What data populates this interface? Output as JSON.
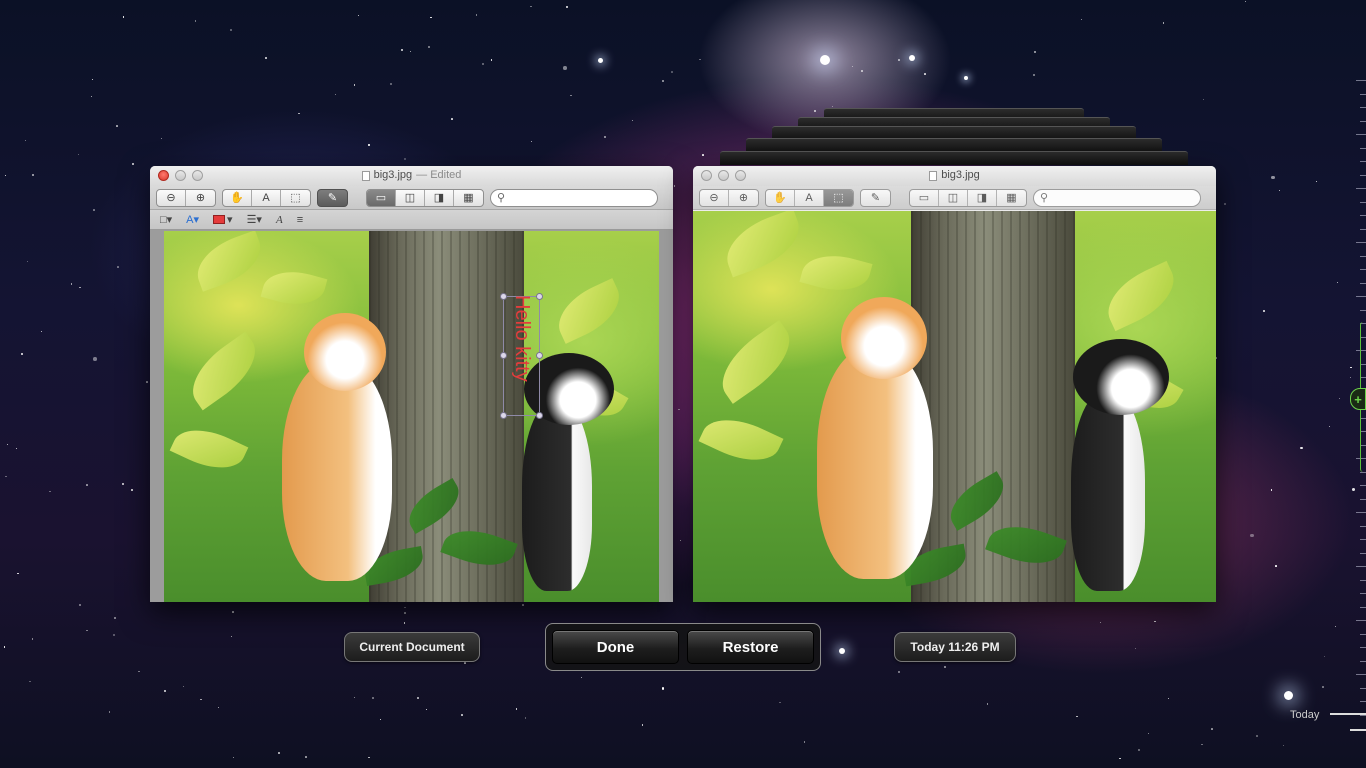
{
  "left_window": {
    "title": "big3.jpg",
    "edited": "— Edited",
    "annotation_text": "Hello kitty"
  },
  "right_window": {
    "title": "big3.jpg"
  },
  "toolbar": {
    "zoom_out": "⊖",
    "zoom_in": "⊕",
    "move": "✋",
    "text_select": "A",
    "rect_select": "⬚",
    "markup": "✎",
    "search_icon": "⚲"
  },
  "markup_toolbar": {
    "shape": "□▾",
    "text_box": "A▾",
    "line": "☰▾",
    "font": "A",
    "list": "≡"
  },
  "controls": {
    "current_document": "Current Document",
    "done": "Done",
    "restore": "Restore",
    "timestamp": "Today 11:26 PM"
  },
  "timeline": {
    "today": "Today",
    "plus": "+"
  },
  "colors": {
    "markup_red": "#e33c3c",
    "timeline_green": "#6cd34a"
  }
}
